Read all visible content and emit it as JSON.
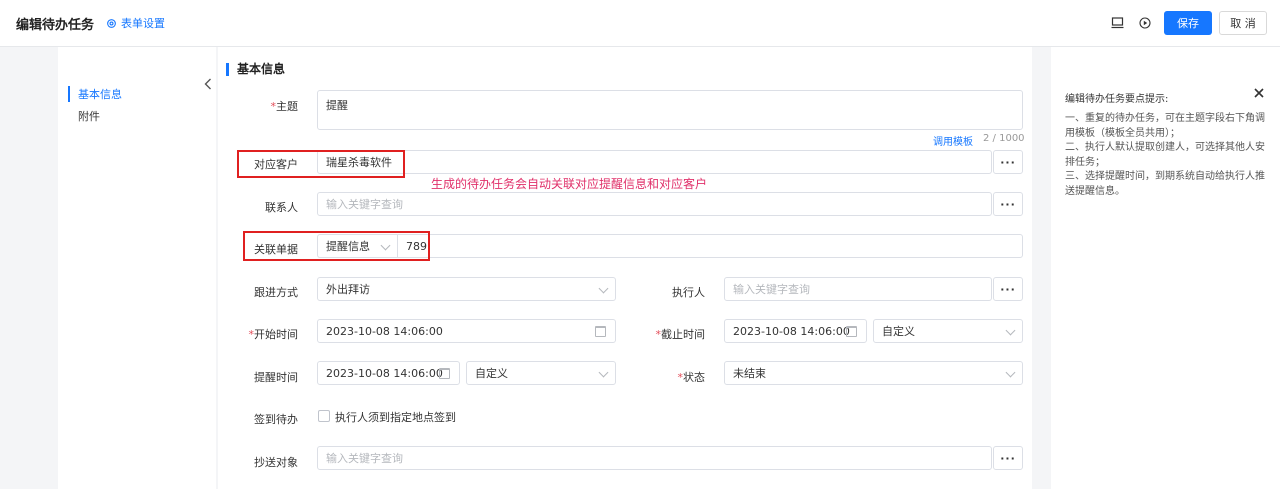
{
  "header": {
    "title": "编辑待办任务",
    "form_settings": "表单设置",
    "save_label": "保存",
    "cancel_label": "取 消"
  },
  "nav": {
    "items": [
      {
        "label": "基本信息",
        "active": true
      },
      {
        "label": "附件",
        "active": false
      }
    ]
  },
  "section": {
    "title": "基本信息"
  },
  "form": {
    "subject": {
      "label": "主题",
      "required_mark": "*",
      "value": "提醒",
      "template_link": "调用模板",
      "counter": "2 / 1000"
    },
    "customer": {
      "label": "对应客户",
      "value": "瑞星杀毒软件"
    },
    "contact": {
      "label": "联系人",
      "placeholder": "输入关键字查询"
    },
    "related_doc": {
      "label": "关联单据",
      "type_value": "提醒信息",
      "id_value": "789"
    },
    "follow_method": {
      "label": "跟进方式",
      "value": "外出拜访"
    },
    "executor": {
      "label": "执行人",
      "placeholder": "输入关键字查询"
    },
    "start_time": {
      "label": "开始时间",
      "required_mark": "*",
      "value": "2023-10-08 14:06:00"
    },
    "deadline": {
      "label": "截止时间",
      "required_mark": "*",
      "value": "2023-10-08 14:06:00",
      "mode": "自定义"
    },
    "reminder_time": {
      "label": "提醒时间",
      "value": "2023-10-08 14:06:00",
      "mode": "自定义"
    },
    "status": {
      "label": "状态",
      "required_mark": "*",
      "value": "未结束"
    },
    "checkin": {
      "label": "签到待办",
      "checkbox_label": "执行人须到指定地点签到"
    },
    "cc": {
      "label": "抄送对象",
      "placeholder": "输入关键字查询"
    },
    "more_glyph": "···"
  },
  "annotation": "生成的待办任务会自动关联对应提醒信息和对应客户",
  "tips": {
    "title": "编辑待办任务要点提示:",
    "lines": [
      "一、重复的待办任务，可在主题字段右下角调用模板（模板全员共用）；",
      "二、执行人默认提取创建人，可选择其他人安排任务；",
      "三、选择提醒时间，到期系统自动给执行人推送提醒信息。"
    ]
  },
  "colors": {
    "accent": "#1677ff",
    "required": "#e34d59",
    "annotation_box": "#e02020",
    "annotation_text": "#e0306a"
  }
}
